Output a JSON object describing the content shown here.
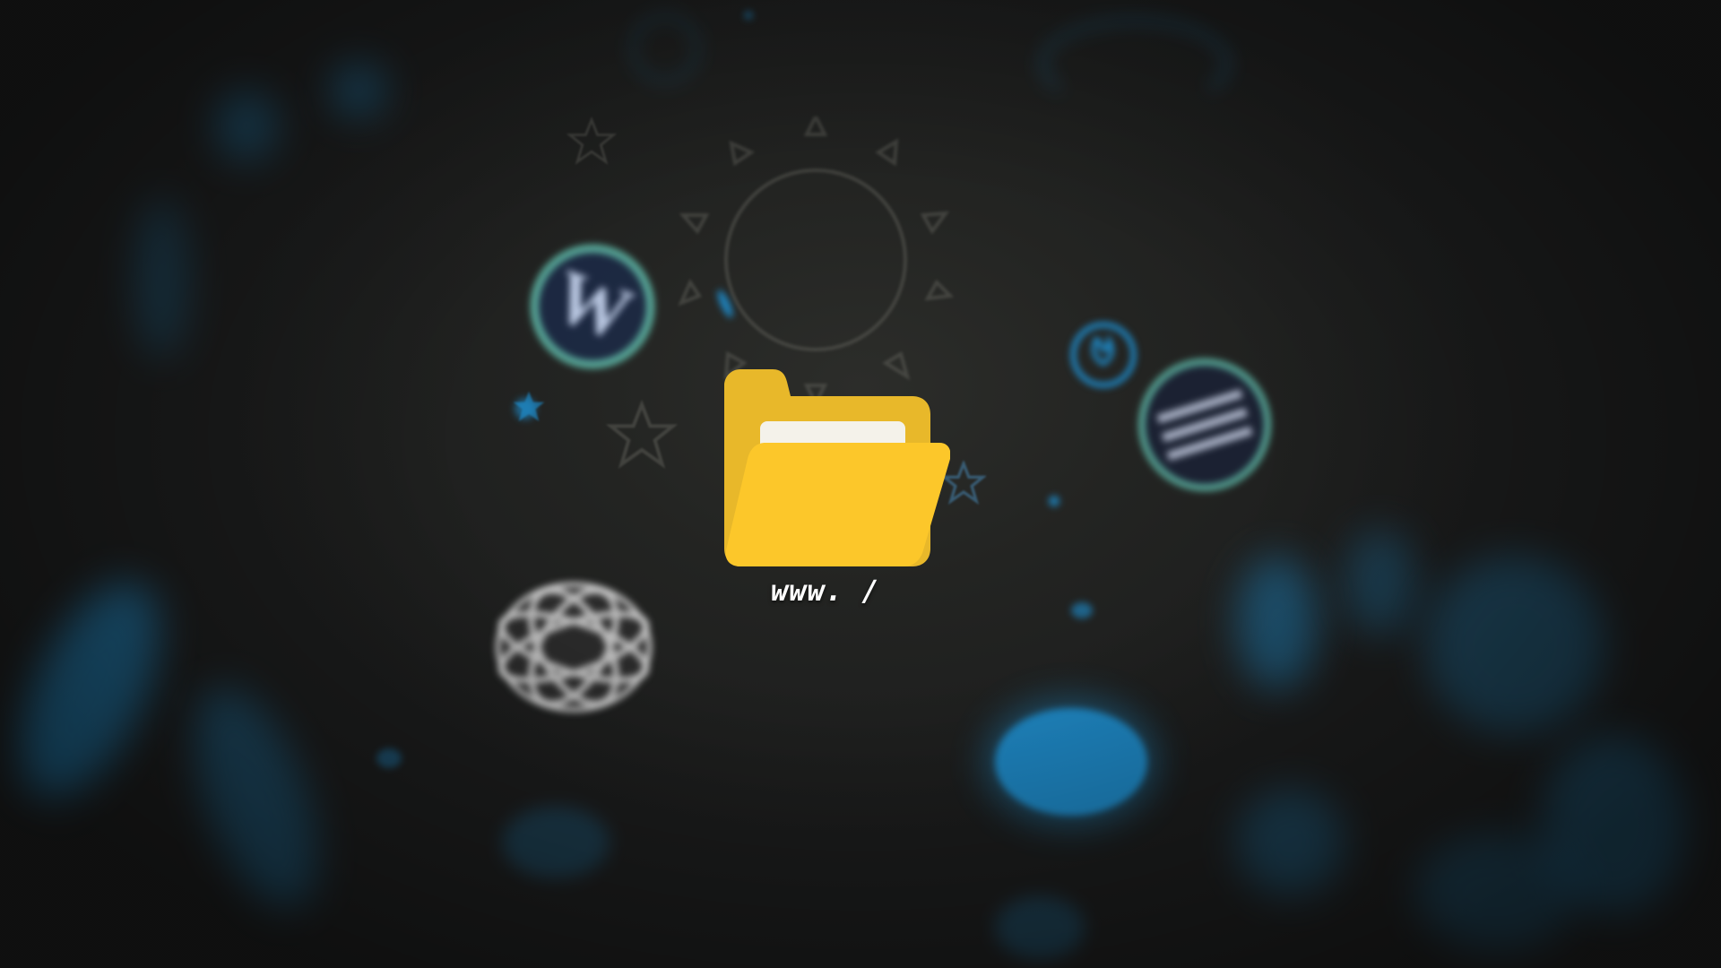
{
  "scene": {
    "folder_icon": "folder-open-icon",
    "url_text": "www. /",
    "accent_color": "#1e8fd0",
    "folder_color": "#fcc72a",
    "folder_back_color": "#e8b82a",
    "background_color": "#1f2020"
  },
  "icons": [
    "wordpress-logo-icon",
    "wordpress-logo-icon",
    "wireframe-globe-icon",
    "flame-emblem-icon",
    "sun-doodle-icon",
    "star-doodle-icon"
  ]
}
